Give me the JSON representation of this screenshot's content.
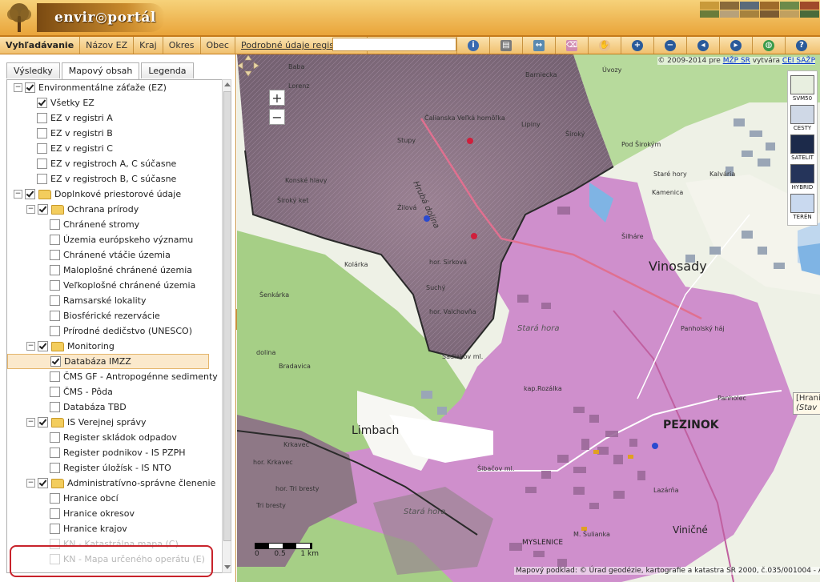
{
  "header": {
    "logo_text": "envir◎portál"
  },
  "nav": {
    "items": [
      "Vyhľadávanie",
      "Názov EZ",
      "Kraj",
      "Okres",
      "Obec",
      "Podrobné údaje registra EZ"
    ]
  },
  "tabs": [
    "Výsledky",
    "Mapový obsah",
    "Legenda"
  ],
  "tree": [
    {
      "label": "Environmentálne záťaže (EZ)",
      "level": 0,
      "exp": "−",
      "cb": true,
      "folder": false
    },
    {
      "label": "Všetky EZ",
      "level": 1,
      "cb": true
    },
    {
      "label": "EZ v registri A",
      "level": 1,
      "cb": false
    },
    {
      "label": "EZ v registri B",
      "level": 1,
      "cb": false
    },
    {
      "label": "EZ v registri C",
      "level": 1,
      "cb": false
    },
    {
      "label": "EZ v registroch A, C súčasne",
      "level": 1,
      "cb": false
    },
    {
      "label": "EZ v registroch B, C súčasne",
      "level": 1,
      "cb": false
    },
    {
      "label": "Doplnkové priestorové údaje",
      "level": 0,
      "exp": "−",
      "cb": true,
      "folder": true
    },
    {
      "label": "Ochrana prírody",
      "level": 1,
      "exp": "−",
      "cb": true,
      "folder": true
    },
    {
      "label": "Chránené stromy",
      "level": 2,
      "cb": false
    },
    {
      "label": "Územia európskeho významu",
      "level": 2,
      "cb": false
    },
    {
      "label": "Chránené vtáčie územia",
      "level": 2,
      "cb": false
    },
    {
      "label": "Maloplošné chránené územia",
      "level": 2,
      "cb": false
    },
    {
      "label": "Veľkoplošné chránené územia",
      "level": 2,
      "cb": false
    },
    {
      "label": "Ramsarské lokality",
      "level": 2,
      "cb": false
    },
    {
      "label": "Biosférické rezervácie",
      "level": 2,
      "cb": false
    },
    {
      "label": "Prírodné dedičstvo (UNESCO)",
      "level": 2,
      "cb": false
    },
    {
      "label": "Monitoring",
      "level": 1,
      "exp": "−",
      "cb": true,
      "folder": true
    },
    {
      "label": "Databáza IMZZ",
      "level": 2,
      "cb": true,
      "selected": true
    },
    {
      "label": "ČMS GF - Antropogénne sedimenty",
      "level": 2,
      "cb": false
    },
    {
      "label": "ČMS - Pôda",
      "level": 2,
      "cb": false
    },
    {
      "label": "Databáza TBD",
      "level": 2,
      "cb": false
    },
    {
      "label": "IS Verejnej správy",
      "level": 1,
      "exp": "−",
      "cb": true,
      "folder": true
    },
    {
      "label": "Register skládok odpadov",
      "level": 2,
      "cb": false
    },
    {
      "label": "Register podnikov - IS PZPH",
      "level": 2,
      "cb": false
    },
    {
      "label": "Register úložísk - IS NTO",
      "level": 2,
      "cb": false
    },
    {
      "label": "Administratívno-správne členenie",
      "level": 1,
      "exp": "−",
      "cb": true,
      "folder": true
    },
    {
      "label": "Hranice obcí",
      "level": 2,
      "cb": false
    },
    {
      "label": "Hranice okresov",
      "level": 2,
      "cb": false
    },
    {
      "label": "Hranice krajov",
      "level": 2,
      "cb": false
    },
    {
      "label": "KN - Katastrálna mapa (C)",
      "level": 2,
      "cb": false,
      "dim": true
    },
    {
      "label": "KN - Mapa určeného operátu (E)",
      "level": 2,
      "cb": false,
      "dim": true
    }
  ],
  "map": {
    "copyright_pre": "© 2009-2014 pre ",
    "copyright_link1": "MŽP SR",
    "copyright_mid": " vytvára ",
    "copyright_link2": "CEI SAŽP",
    "zoom_in": "+",
    "zoom_out": "−",
    "layers": [
      {
        "name": "SVM50",
        "color": "#e8efe0"
      },
      {
        "name": "CESTY",
        "color": "#cfd8e6"
      },
      {
        "name": "SATELIT",
        "color": "#1c2a4a"
      },
      {
        "name": "HYBRID",
        "color": "#25345a"
      },
      {
        "name": "TERÉN",
        "color": "#c9d9ef"
      }
    ],
    "popup_line1": "[Hrani",
    "popup_line2": "(Stav",
    "scale": [
      "0",
      "0.5",
      "1 km"
    ],
    "footer": "Mapový podklad: © Úrad geodézie, kartografie a katastra SR 2000, č.035/001004 - AG, SVM50",
    "labels": {
      "vinosady": "Vinosady",
      "pezinok": "PEZINOK",
      "limbach": "Limbach",
      "vinicne": "Viničné",
      "myslenice": "MYSLENICE",
      "uvozy": "Úvozy",
      "barniecka": "Barniecka",
      "calianska": "Čalianska Veľká homôľka",
      "hruba_dolina": "Hrubá dolina",
      "stara_hora1": "Stará hora",
      "stara_hora2": "Stará hora",
      "kap_rozalka": "kap.Rozálka",
      "panholec": "Panholec",
      "panholsky_haj": "Panholský háj",
      "kalvaria": "Kalvária",
      "kamenica": "Kamenica",
      "stare_hory": "Staré hory",
      "silhare": "Šilháre",
      "pod_sirokym": "Pod Širokým",
      "siroky": "Široký",
      "lipiny": "Lipiny",
      "zilova": "Žilová",
      "stupy": "Stupy",
      "hor_sirkova": "hor. Sirková",
      "hor_valchovna": "hor. Valchovňa",
      "suchy": "Suchý",
      "kolarka": "Kolárka",
      "sadlakov": "Sadlakov ml.",
      "lazarna": "Lazárňa",
      "m_sulianka": "M. Šulianka",
      "hor_krkavec": "hor. Krkavec",
      "krkavec": "Krkavec",
      "bradavica": "Bradavica",
      "senkarka": "Šenkárka",
      "tri_bresty1": "hor. Tri bresty",
      "tri_bresty2": "Tri bresty",
      "konske_hlavy": "Konské hlavy",
      "siroky_ket": "Široký ket",
      "sibacov": "Šibačov ml.",
      "dolina": "dolina",
      "baba": "Baba",
      "lorenz": "Lorenz"
    }
  }
}
